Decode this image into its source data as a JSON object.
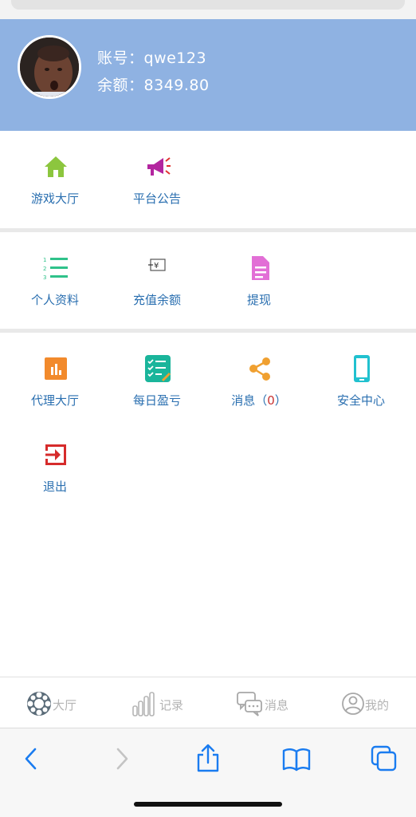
{
  "profile": {
    "account_label": "账号：",
    "account": "qwe123",
    "balance_label": "余额：",
    "balance": "8349.80"
  },
  "section1": [
    {
      "label": "游戏大厅",
      "icon": "home-icon"
    },
    {
      "label": "平台公告",
      "icon": "megaphone-icon"
    }
  ],
  "section2": [
    {
      "label": "个人资料",
      "icon": "list-icon"
    },
    {
      "label": "充值余额",
      "icon": "yen-deposit-icon"
    },
    {
      "label": "提现",
      "icon": "document-icon"
    }
  ],
  "section3": [
    {
      "label": "代理大厅",
      "icon": "bar-chart-icon"
    },
    {
      "label": "每日盈亏",
      "icon": "checklist-icon"
    },
    {
      "label": "消息（",
      "count": "0",
      "suffix": "）",
      "icon": "share-icon"
    },
    {
      "label": "安全中心",
      "icon": "phone-icon"
    },
    {
      "label": "退出",
      "icon": "logout-icon"
    }
  ],
  "tabbar": [
    {
      "label": "大厅",
      "icon": "lobby-icon"
    },
    {
      "label": "记录",
      "icon": "stats-icon"
    },
    {
      "label": "消息",
      "icon": "chat-icon"
    },
    {
      "label": "我的",
      "icon": "user-icon"
    }
  ],
  "colors": {
    "header_bg": "#8fb2e2",
    "label_blue": "#2a6fb0",
    "tab_inactive": "#b3b3b3",
    "safari_blue": "#1a7cf0"
  }
}
